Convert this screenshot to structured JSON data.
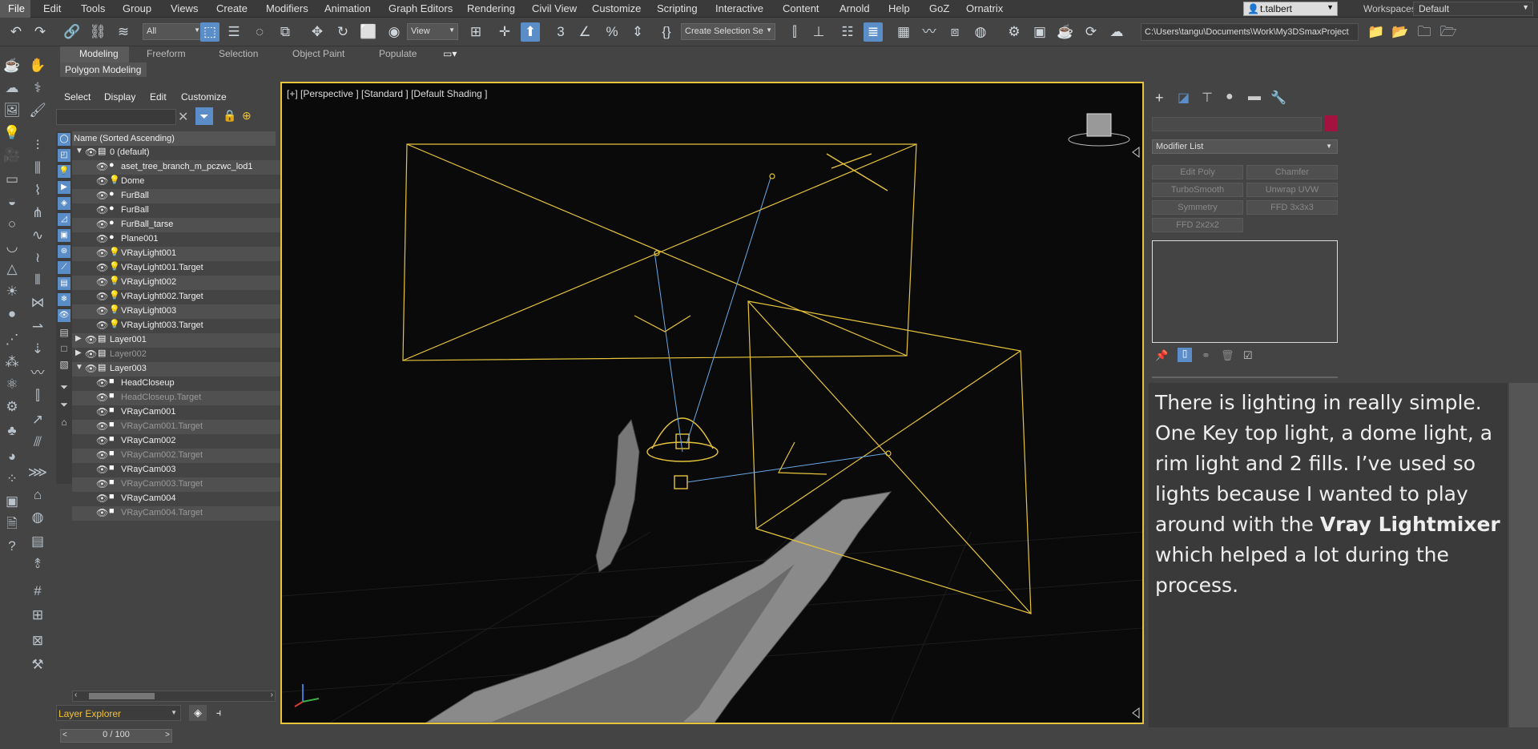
{
  "menubar": {
    "file": "File",
    "items": [
      "Edit",
      "Tools",
      "Group",
      "Views",
      "Create",
      "Modifiers",
      "Animation",
      "Graph Editors",
      "Rendering",
      "Civil View",
      "Customize",
      "Scripting",
      "Interactive",
      "Content",
      "Arnold",
      "Help",
      "GoZ",
      "Ornatrix"
    ],
    "user": "t.talbert",
    "workspaces_label": "Workspaces:",
    "workspace": "Default"
  },
  "toolbar": {
    "filter": "All",
    "view": "View",
    "selection_set": "Create Selection Se",
    "project_path": "C:\\Users\\tangu\\Documents\\Work\\My3DSmaxProject"
  },
  "ribbon": {
    "tabs": [
      "Modeling",
      "Freeform",
      "Selection",
      "Object Paint",
      "Populate"
    ],
    "panel": "Polygon Modeling"
  },
  "explorer": {
    "menus": [
      "Select",
      "Display",
      "Edit",
      "Customize"
    ],
    "column_header": "Name (Sorted Ascending)",
    "rows": [
      {
        "label": "0 (default)",
        "level": 0,
        "type": "layer",
        "expanded": true,
        "dim": false
      },
      {
        "label": "aset_tree_branch_m_pczwc_lod1",
        "level": 1,
        "type": "geo",
        "dim": false
      },
      {
        "label": "Dome",
        "level": 1,
        "type": "light",
        "dim": false
      },
      {
        "label": "FurBall",
        "level": 1,
        "type": "geo",
        "dim": false
      },
      {
        "label": "FurBall",
        "level": 1,
        "type": "geo",
        "dim": false
      },
      {
        "label": "FurBall_tarse",
        "level": 1,
        "type": "geo",
        "dim": false
      },
      {
        "label": "Plane001",
        "level": 1,
        "type": "geo",
        "dim": false
      },
      {
        "label": "VRayLight001",
        "level": 1,
        "type": "light",
        "dim": false
      },
      {
        "label": "VRayLight001.Target",
        "level": 1,
        "type": "light",
        "dim": false
      },
      {
        "label": "VRayLight002",
        "level": 1,
        "type": "light",
        "dim": false
      },
      {
        "label": "VRayLight002.Target",
        "level": 1,
        "type": "light",
        "dim": false
      },
      {
        "label": "VRayLight003",
        "level": 1,
        "type": "light",
        "dim": false
      },
      {
        "label": "VRayLight003.Target",
        "level": 1,
        "type": "light",
        "dim": false
      },
      {
        "label": "Layer001",
        "level": 0,
        "type": "layer",
        "expanded": false,
        "dim": false
      },
      {
        "label": "Layer002",
        "level": 0,
        "type": "layer",
        "expanded": false,
        "dim": true
      },
      {
        "label": "Layer003",
        "level": 0,
        "type": "layer",
        "expanded": true,
        "dim": false
      },
      {
        "label": "HeadCloseup",
        "level": 1,
        "type": "cam",
        "dim": false
      },
      {
        "label": "HeadCloseup.Target",
        "level": 1,
        "type": "cam",
        "dim": true
      },
      {
        "label": "VRayCam001",
        "level": 1,
        "type": "cam",
        "dim": false
      },
      {
        "label": "VRayCam001.Target",
        "level": 1,
        "type": "cam",
        "dim": true
      },
      {
        "label": "VRayCam002",
        "level": 1,
        "type": "cam",
        "dim": false
      },
      {
        "label": "VRayCam002.Target",
        "level": 1,
        "type": "cam",
        "dim": true
      },
      {
        "label": "VRayCam003",
        "level": 1,
        "type": "cam",
        "dim": false
      },
      {
        "label": "VRayCam003.Target",
        "level": 1,
        "type": "cam",
        "dim": true
      },
      {
        "label": "VRayCam004",
        "level": 1,
        "type": "cam",
        "dim": false
      },
      {
        "label": "VRayCam004.Target",
        "level": 1,
        "type": "cam",
        "dim": true
      }
    ],
    "footer": "Layer Explorer",
    "timeline": "0 / 100"
  },
  "viewport": {
    "label": "[+] [Perspective ] [Standard ] [Default Shading ]",
    "accent": "#e6c43c"
  },
  "command_panel": {
    "modifier_list": "Modifier List",
    "buttons": [
      "Edit Poly",
      "Chamfer",
      "TurboSmooth",
      "Unwrap UVW",
      "Symmetry",
      "FFD 3x3x3",
      "FFD 2x2x2"
    ],
    "object_color": "#a31340"
  },
  "caption": {
    "before": "There is lighting in really simple. One Key top light, a dome light, a rim light and 2 fills. I’ve used so lights because I wanted to play around with the ",
    "bold": "Vray Lightmixer",
    "after": " which helped a lot during the process."
  }
}
